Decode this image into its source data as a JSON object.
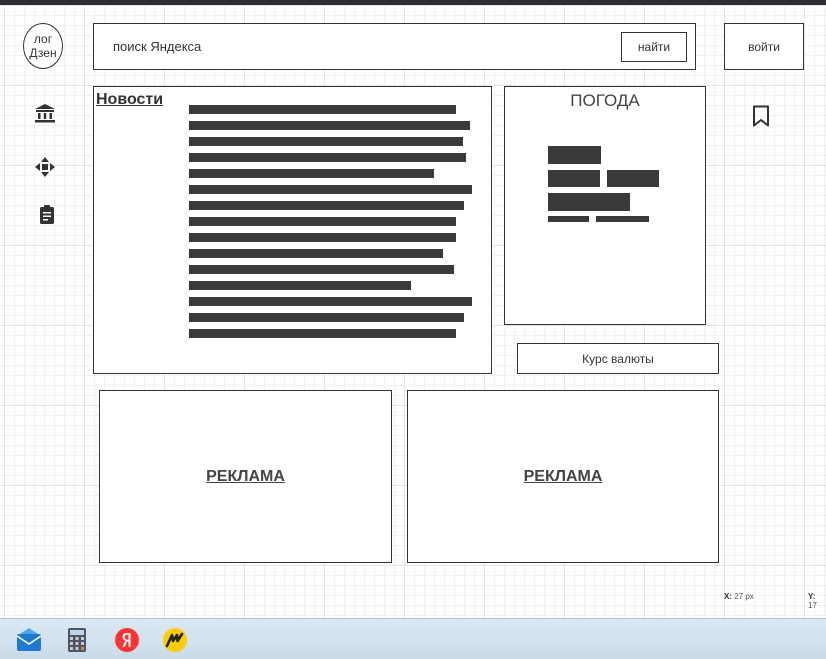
{
  "logo": {
    "text": "лог\nДзен"
  },
  "search": {
    "placeholder": "поиск Яндекса",
    "button_label": "найти"
  },
  "login": {
    "label": "войти"
  },
  "sidebar": {
    "icons": [
      "bank-icon",
      "move-arrows-icon",
      "clipboard-icon"
    ]
  },
  "bookmark": {
    "icon": "bookmark-icon"
  },
  "news": {
    "title": "Новости "
  },
  "weather": {
    "title": "ПОГОДА"
  },
  "currency": {
    "label": "Курс валюты"
  },
  "ads": [
    {
      "label": "РЕКЛАМА"
    },
    {
      "label": "РЕКЛАМА"
    }
  ],
  "status": {
    "x_label": "X:",
    "x_value": "27 px",
    "y_label": "Y:",
    "y_value": "17"
  },
  "taskbar": {
    "icons": [
      "mail-icon",
      "calculator-icon",
      "yandex-icon",
      "yandex-market-icon"
    ]
  },
  "colors": {
    "wireframe_dark": "#3a3a3a",
    "yandex_red": "#f33",
    "market_yellow": "#ffcc00"
  }
}
